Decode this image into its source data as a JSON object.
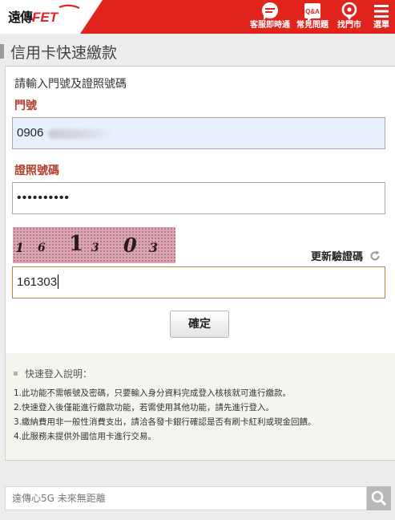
{
  "header": {
    "logo_cn": "遠傳",
    "logo_en": "FET",
    "nav": [
      {
        "label": "客服即時通",
        "icon": "chat-icon"
      },
      {
        "label": "常見問題",
        "icon": "qa-icon"
      },
      {
        "label": "找門市",
        "icon": "location-pin-icon"
      },
      {
        "label": "選單",
        "icon": "menu-icon"
      }
    ],
    "qa_badge": "Q&A"
  },
  "page_title": "信用卡快速繳款",
  "form": {
    "instruction": "請輸入門號及證照號碼",
    "phone_label": "門號",
    "phone_value": "0906",
    "id_label": "證照號碼",
    "id_value": "••••••••••",
    "captcha_digits": [
      "1",
      "6",
      "1",
      "3",
      "0",
      "3"
    ],
    "refresh_label": "更新驗證碼",
    "captcha_value": "161303",
    "confirm_label": "確定"
  },
  "notes": {
    "heading": "快速登入說明：",
    "items": [
      "1.此功能不需帳號及密碼，只要輸入身分資料完成登入核核就可進行繳款。",
      "2.快速登入後僅能進行繳款功能，若需使用其他功能，請先進行登入。",
      "3.繳納費用非一般性消費支出，請洽各發卡銀行確認是否有刷卡紅利或現金回饋。",
      "4.此服務未提供外國信用卡進行交易。"
    ]
  },
  "search": {
    "placeholder": "遠傳心5G 未來無距離"
  },
  "colors": {
    "brand_red": "#e0231c",
    "label_brown": "#b0402a"
  }
}
